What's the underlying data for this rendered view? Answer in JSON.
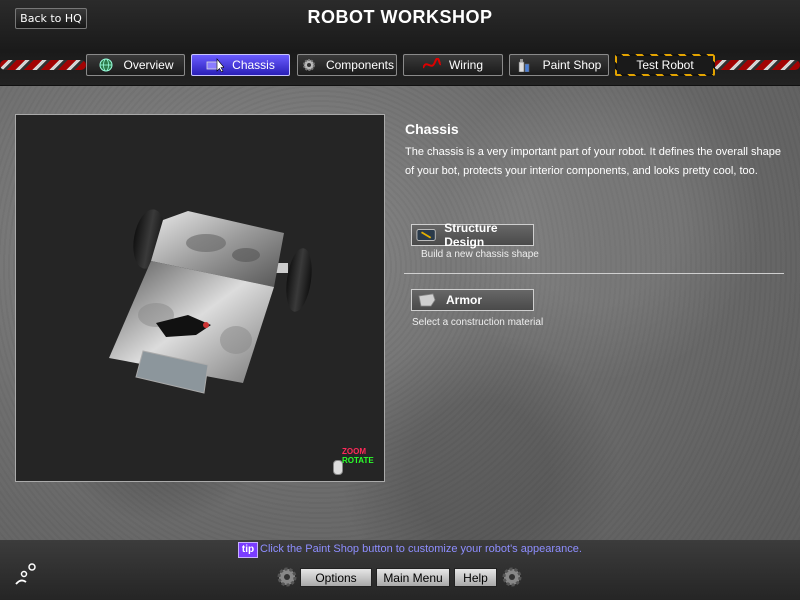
{
  "header": {
    "back_label": "Back to HQ",
    "title": "ROBOT WORKSHOP"
  },
  "tabs": [
    {
      "label": "Overview",
      "icon": "globe-icon",
      "active": false
    },
    {
      "label": "Chassis",
      "icon": "cursor-icon",
      "active": true
    },
    {
      "label": "Components",
      "icon": "gear-icon",
      "active": false
    },
    {
      "label": "Wiring",
      "icon": "wire-icon",
      "active": false
    },
    {
      "label": "Paint Shop",
      "icon": "paint-cans-icon",
      "active": false
    },
    {
      "label": "Test Robot",
      "icon": "hazard-stripes",
      "active": false
    }
  ],
  "viewport": {
    "zoom_label": "ZOOM",
    "rotate_label": "ROTATE"
  },
  "panel": {
    "title": "Chassis",
    "description": "The chassis is a very important part of your robot. It defines the overall shape of your bot, protects your interior components, and looks pretty cool, too.",
    "options": [
      {
        "label": "Structure Design",
        "sub": "Build a new chassis shape",
        "icon": "blueprint-icon"
      },
      {
        "label": "Armor",
        "sub": "Select a construction material",
        "icon": "armor-plate-icon"
      }
    ]
  },
  "footer": {
    "tip_badge": "tip",
    "tip_text": "Click the Paint Shop button to customize your robot's appearance.",
    "buttons": [
      "Options",
      "Main Menu",
      "Help"
    ]
  },
  "colors": {
    "active_tab": "#5a4cf0",
    "tip_text": "#8e8eff",
    "zoom": "#ff2a5a",
    "rotate": "#2aff2a"
  }
}
